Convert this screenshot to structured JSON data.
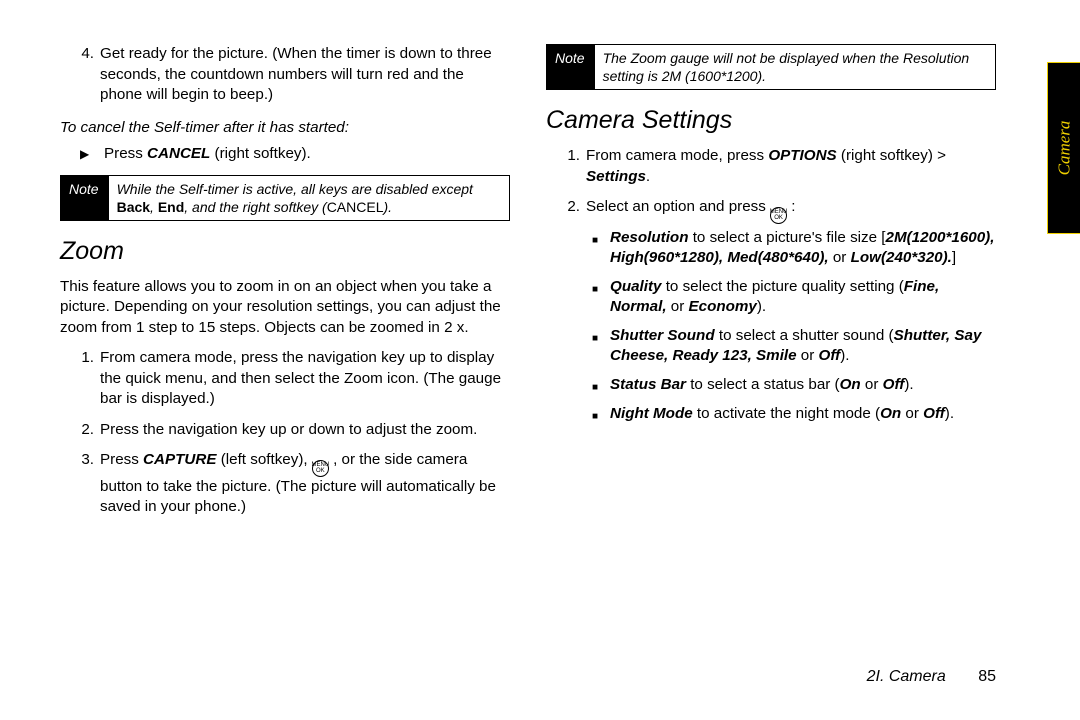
{
  "left": {
    "step4": "Get ready for the picture. (When the timer is down to three seconds, the countdown numbers will turn red and the phone will begin to beep.)",
    "cancel_heading": "To cancel the Self-timer after it has started:",
    "cancel_pre": "Press ",
    "cancel_key": "CANCEL",
    "cancel_post": " (right softkey).",
    "note_label": "Note",
    "note_pre": "While the Self-timer is active, all keys are disabled except ",
    "note_k1": "Back",
    "note_k2": "End",
    "note_mid": ", and the right softkey (",
    "note_k3": "CANCEL",
    "note_end": ").",
    "zoom_h": "Zoom",
    "zoom_p": "This feature allows you to zoom in on an object when you take a picture. Depending on your resolution settings, you can adjust the zoom from 1 step to 15 steps. Objects can be zoomed in 2 x.",
    "z1": "From camera mode, press the navigation key up to display the quick menu, and then select the Zoom icon. (The gauge bar is displayed.)",
    "z2": "Press the navigation key up or down to adjust the zoom.",
    "z3_pre": "Press ",
    "z3_key": "CAPTURE",
    "z3_mid": " (left softkey), ",
    "z3_post": " , or the side camera button to take the picture. (The picture will automatically be saved in your phone.)"
  },
  "right": {
    "note_label": "Note",
    "note_text": "The Zoom gauge will not be displayed when the Resolution setting is 2M (1600*1200).",
    "cs_h": "Camera Settings",
    "s1_pre": "From camera mode, press ",
    "s1_key": "OPTIONS",
    "s1_mid": " (right softkey) > ",
    "s1_key2": "Settings",
    "s1_end": ".",
    "s2_pre": "Select an option and press ",
    "s2_post": " :",
    "b1_k": "Resolution",
    "b1_t": " to select a picture's file size [",
    "b1_v": "2M(1200*1600), High(960*1280), Med(480*640),",
    "b1_or": " or ",
    "b1_v2": "Low(240*320).",
    "b1_end": "]",
    "b2_k": "Quality",
    "b2_t": " to select the picture quality setting (",
    "b2_v": "Fine, Normal,",
    "b2_or": " or ",
    "b2_v2": "Economy",
    "b2_end": ").",
    "b3_k": "Shutter Sound",
    "b3_t": " to select a shutter sound (",
    "b3_v": "Shutter, Say Cheese, Ready 123, Smile",
    "b3_or": " or ",
    "b3_v2": "Off",
    "b3_end": ").",
    "b4_k": "Status Bar",
    "b4_t": " to select a status bar (",
    "b4_v": "On",
    "b4_or": " or ",
    "b4_v2": "Off",
    "b4_end": ").",
    "b5_k": "Night Mode",
    "b5_t": " to activate the night mode (",
    "b5_v": "On",
    "b5_or": " or ",
    "b5_v2": "Off",
    "b5_end": ")."
  },
  "footer": {
    "chapter": "2I. Camera",
    "page": "85"
  },
  "tab": "Camera",
  "ok": {
    "t1": "MENU",
    "t2": "OK"
  }
}
